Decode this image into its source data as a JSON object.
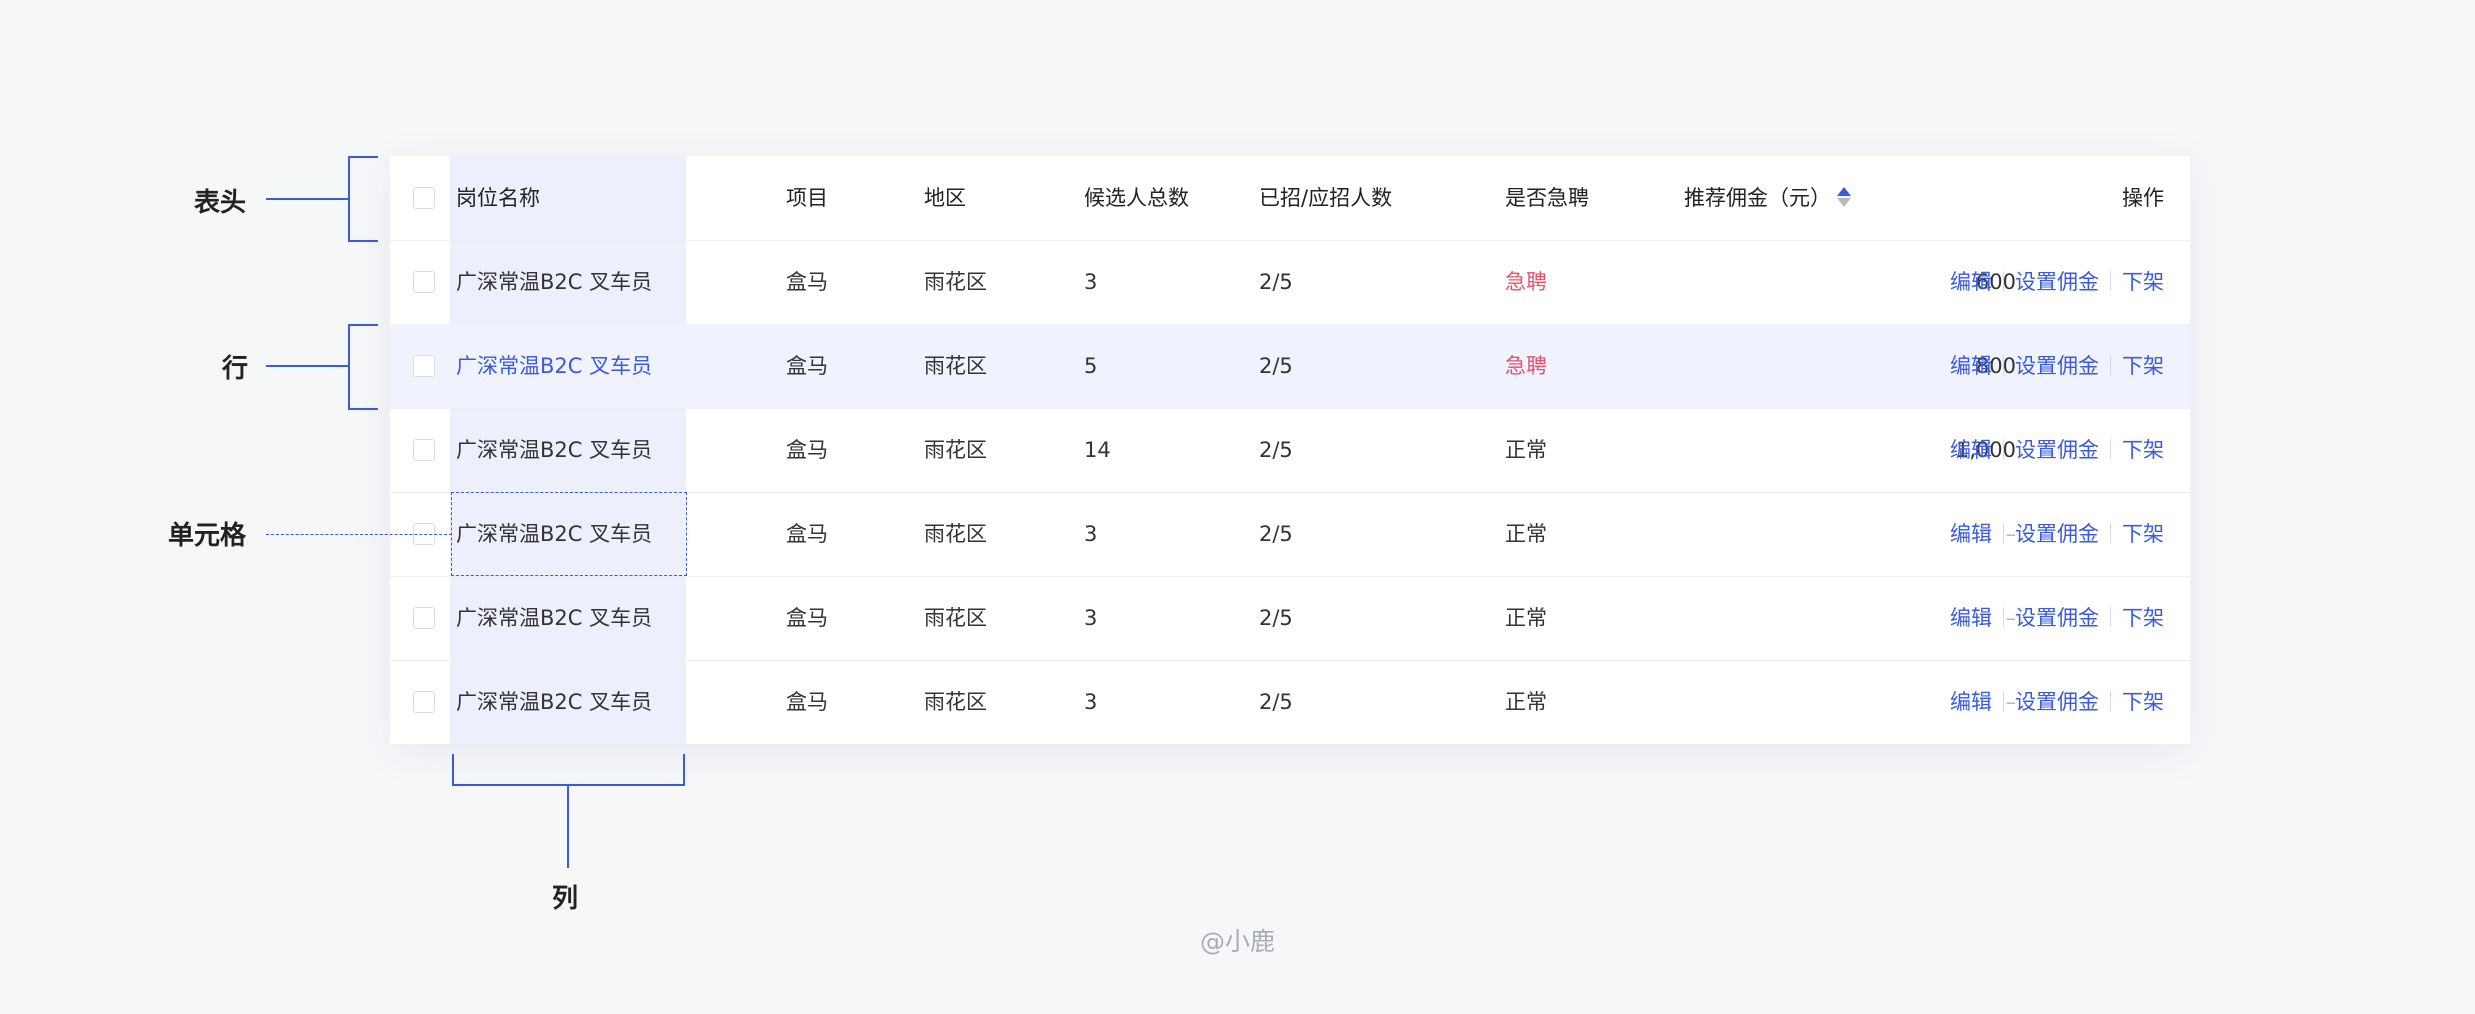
{
  "table": {
    "header": {
      "name": "岗位名称",
      "project": "项目",
      "region": "地区",
      "candidates": "候选人总数",
      "hired": "已招/应招人数",
      "urgent": "是否急聘",
      "commission": "推荐佣金（元）",
      "operations": "操作"
    },
    "rows": [
      {
        "name": "广深常温B2C 叉车员",
        "project": "盒马",
        "region": "雨花区",
        "candidates": "3",
        "hired": "2/5",
        "urgent": "急聘",
        "commission": "600"
      },
      {
        "name": "广深常温B2C 叉车员",
        "project": "盒马",
        "region": "雨花区",
        "candidates": "5",
        "hired": "2/5",
        "urgent": "急聘",
        "commission": "800"
      },
      {
        "name": "广深常温B2C 叉车员",
        "project": "盒马",
        "region": "雨花区",
        "candidates": "14",
        "hired": "2/5",
        "urgent": "正常",
        "commission": "1,000"
      },
      {
        "name": "广深常温B2C 叉车员",
        "project": "盒马",
        "region": "雨花区",
        "candidates": "3",
        "hired": "2/5",
        "urgent": "正常",
        "commission": "–"
      },
      {
        "name": "广深常温B2C 叉车员",
        "project": "盒马",
        "region": "雨花区",
        "candidates": "3",
        "hired": "2/5",
        "urgent": "正常",
        "commission": "–"
      },
      {
        "name": "广深常温B2C 叉车员",
        "project": "盒马",
        "region": "雨花区",
        "candidates": "3",
        "hired": "2/5",
        "urgent": "正常",
        "commission": "–"
      }
    ],
    "actions": {
      "edit": "编辑",
      "set_commission": "设置佣金",
      "remove": "下架"
    }
  },
  "annotations": {
    "header": "表头",
    "row": "行",
    "cell": "单元格",
    "column": "列"
  },
  "watermark": "@小鹿",
  "colors": {
    "accent": "#3a5ae0",
    "urgent": "#e5536d",
    "column_highlight": "#e1e5f9",
    "row_hover": "#f0f3fe"
  },
  "icons": {
    "sort": "sort-caret-icon",
    "checkbox": "checkbox-icon"
  }
}
